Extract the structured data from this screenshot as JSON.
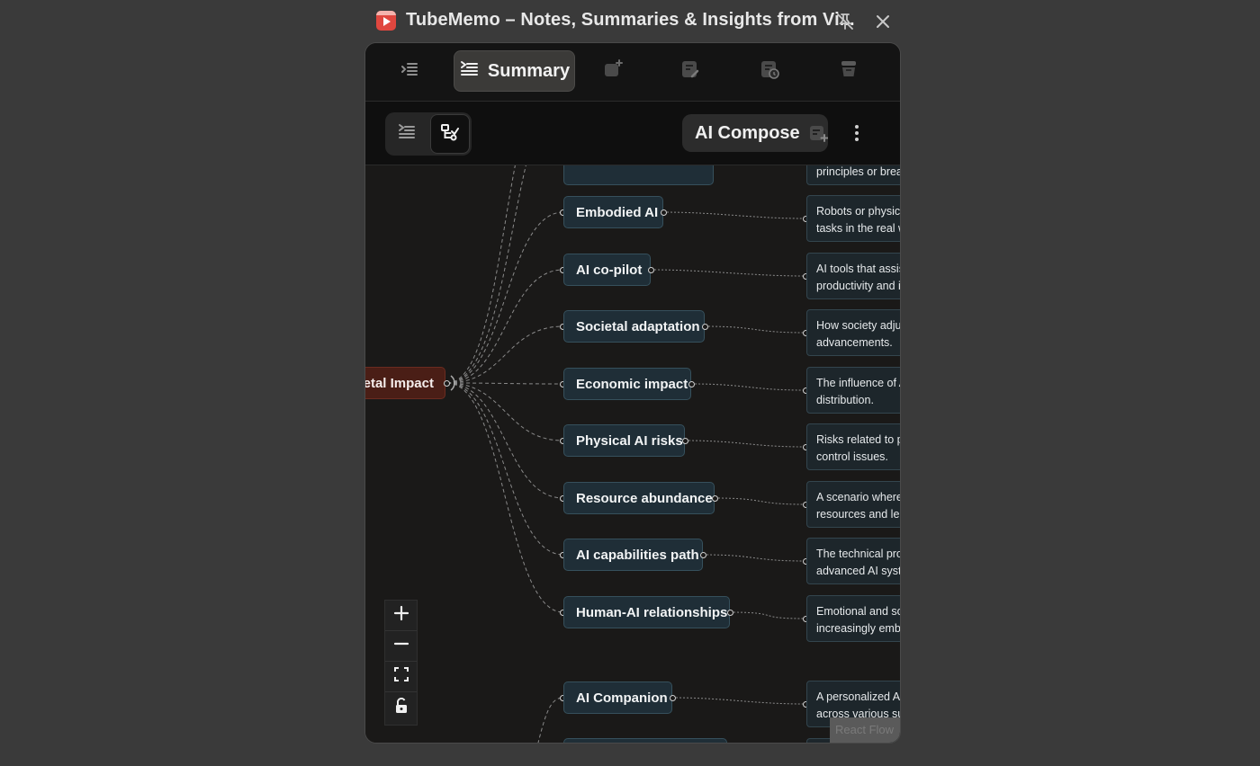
{
  "window": {
    "title": "TubeMemo – Notes, Summaries & Insights from Vi...",
    "pin_icon": "unpin-icon",
    "close_icon": "close-icon"
  },
  "tabs": [
    {
      "id": "outline",
      "icon": "outline-list-icon",
      "label": ""
    },
    {
      "id": "summary",
      "icon": "summary-list-icon",
      "label": "Summary",
      "active": true
    },
    {
      "id": "chat",
      "icon": "chat-plus-icon",
      "label": ""
    },
    {
      "id": "notes",
      "icon": "note-edit-icon",
      "label": ""
    },
    {
      "id": "history",
      "icon": "note-history-icon",
      "label": ""
    },
    {
      "id": "archive",
      "icon": "archive-icon",
      "label": ""
    }
  ],
  "toolbar": {
    "view_list_icon": "list-view-icon",
    "view_mindmap_icon": "mindmap-view-icon",
    "active_view": "mindmap",
    "compose_label": "AI Compose",
    "compose_icon": "compose-note-icon",
    "more_icon": "more-vertical-icon"
  },
  "mindmap": {
    "root": "etal Impact",
    "partial_top_desc": "principles or brea",
    "nodes": [
      {
        "label": "Embodied AI",
        "desc": [
          "Robots or physica",
          "tasks in the real w"
        ]
      },
      {
        "label": "AI co-pilot",
        "desc": [
          "AI tools that assis",
          "productivity and i"
        ]
      },
      {
        "label": "Societal adaptation",
        "desc": [
          "How society adju",
          "advancements."
        ]
      },
      {
        "label": "Economic impact",
        "desc": [
          "The influence of A",
          "distribution."
        ]
      },
      {
        "label": "Physical AI risks",
        "desc": [
          "Risks related to p",
          "control issues."
        ]
      },
      {
        "label": "Resource abundance",
        "desc": [
          "A scenario where",
          "resources and lei"
        ]
      },
      {
        "label": "AI capabilities path",
        "desc": [
          "The technical pro",
          "advanced AI syst"
        ]
      },
      {
        "label": "Human-AI relationships",
        "desc": [
          "Emotional and so",
          "increasingly emb"
        ]
      },
      {
        "label": "AI Companion",
        "desc": [
          "A personalized AI",
          "across various su"
        ]
      }
    ]
  },
  "controls": {
    "zoom_in_icon": "plus-icon",
    "zoom_out_icon": "minus-icon",
    "fit_view_icon": "fit-view-icon",
    "lock_icon": "unlock-icon"
  },
  "attribution": "React Flow"
}
